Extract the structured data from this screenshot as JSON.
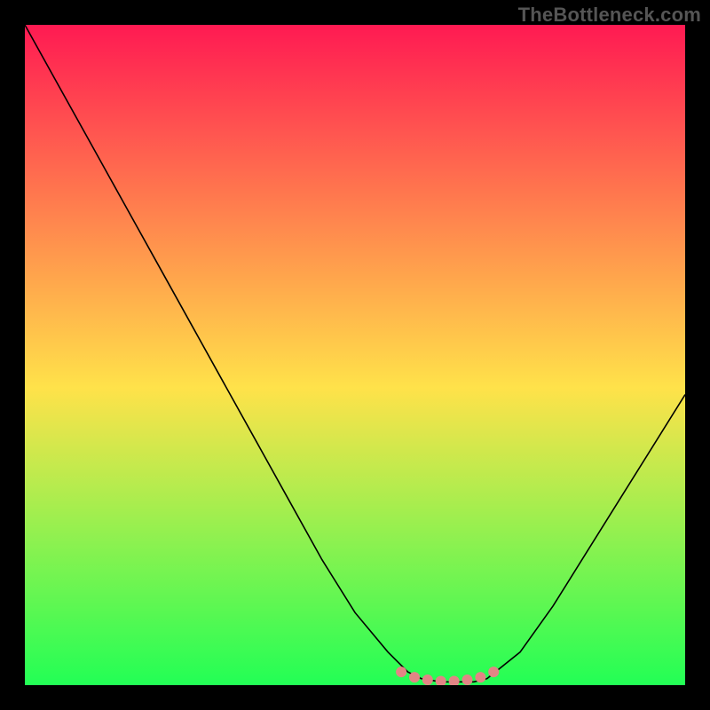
{
  "watermark": "TheBottleneck.com",
  "background_color": "#000000",
  "gradient_top": "#ff1a52",
  "gradient_mid": "#ffe24a",
  "gradient_bottom": "#22ff55",
  "curve_color": "#000000",
  "marker_color": "#e28585",
  "chart_data": {
    "type": "line",
    "title": "",
    "xlabel": "",
    "ylabel": "",
    "xlim": [
      0,
      100
    ],
    "ylim": [
      0,
      100
    ],
    "x": [
      0,
      5,
      10,
      15,
      20,
      25,
      30,
      35,
      40,
      45,
      50,
      55,
      58,
      60,
      63,
      65,
      68,
      70,
      75,
      80,
      85,
      90,
      95,
      100
    ],
    "values": [
      100,
      91,
      82,
      73,
      64,
      55,
      46,
      37,
      28,
      19,
      11,
      5,
      2,
      1,
      0.5,
      0.5,
      0.5,
      1,
      5,
      12,
      20,
      28,
      36,
      44
    ],
    "markers": {
      "x": [
        57,
        59,
        61,
        63,
        65,
        67,
        69,
        71
      ],
      "y": [
        2,
        1.2,
        0.8,
        0.6,
        0.6,
        0.8,
        1.2,
        2
      ]
    }
  }
}
